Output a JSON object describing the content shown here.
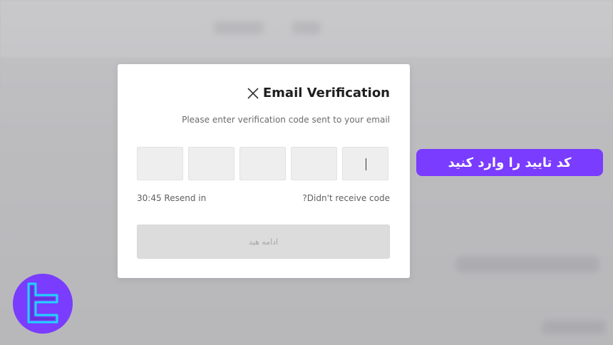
{
  "modal": {
    "title": "Email Verification",
    "subtitle": "Please enter verification code sent to your email",
    "code_boxes": [
      "",
      "",
      "",
      "",
      ""
    ],
    "timer_text": "30:45 Resend in",
    "resend_link": "?Didn't receive code",
    "continue_button": "ادامه هید"
  },
  "callout": {
    "text": "کد تایید را وارد کنید"
  },
  "colors": {
    "accent": "#7a3cff",
    "logo_stroke": "#1fd4ff"
  },
  "icons": {
    "close": "close-icon",
    "logo": "brand-logo-icon"
  }
}
